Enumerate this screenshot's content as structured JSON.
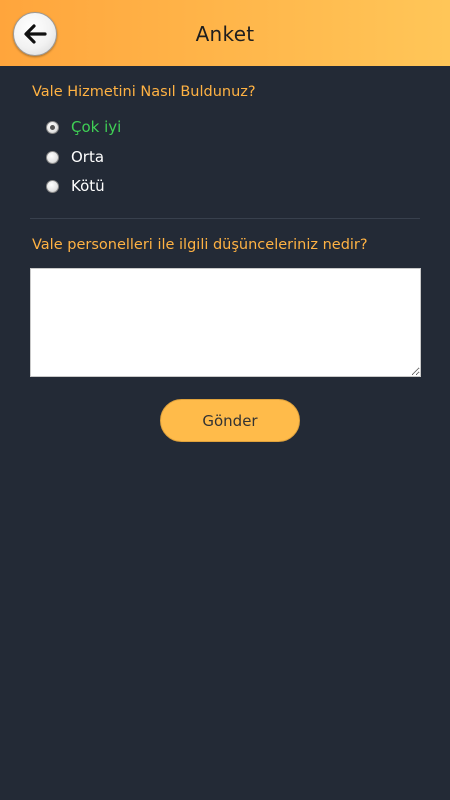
{
  "header": {
    "title": "Anket",
    "back_icon": "arrow-left-icon"
  },
  "question1": {
    "label": "Vale Hizmetini Nasıl Buldunuz?",
    "selected_index": 0,
    "options": [
      "Çok iyi",
      "Orta",
      "Kötü"
    ]
  },
  "question2": {
    "label": "Vale personelleri ile ilgili düşünceleriniz nedir?",
    "value": ""
  },
  "submit": {
    "label": "Gönder"
  },
  "colors": {
    "header_gradient_start": "#ffa53c",
    "header_gradient_end": "#ffc658",
    "background": "#232a36",
    "question_text": "#ffb243",
    "selected_option": "#3fcf55",
    "option_text": "#ffffff",
    "button": "#ffbb4a"
  }
}
